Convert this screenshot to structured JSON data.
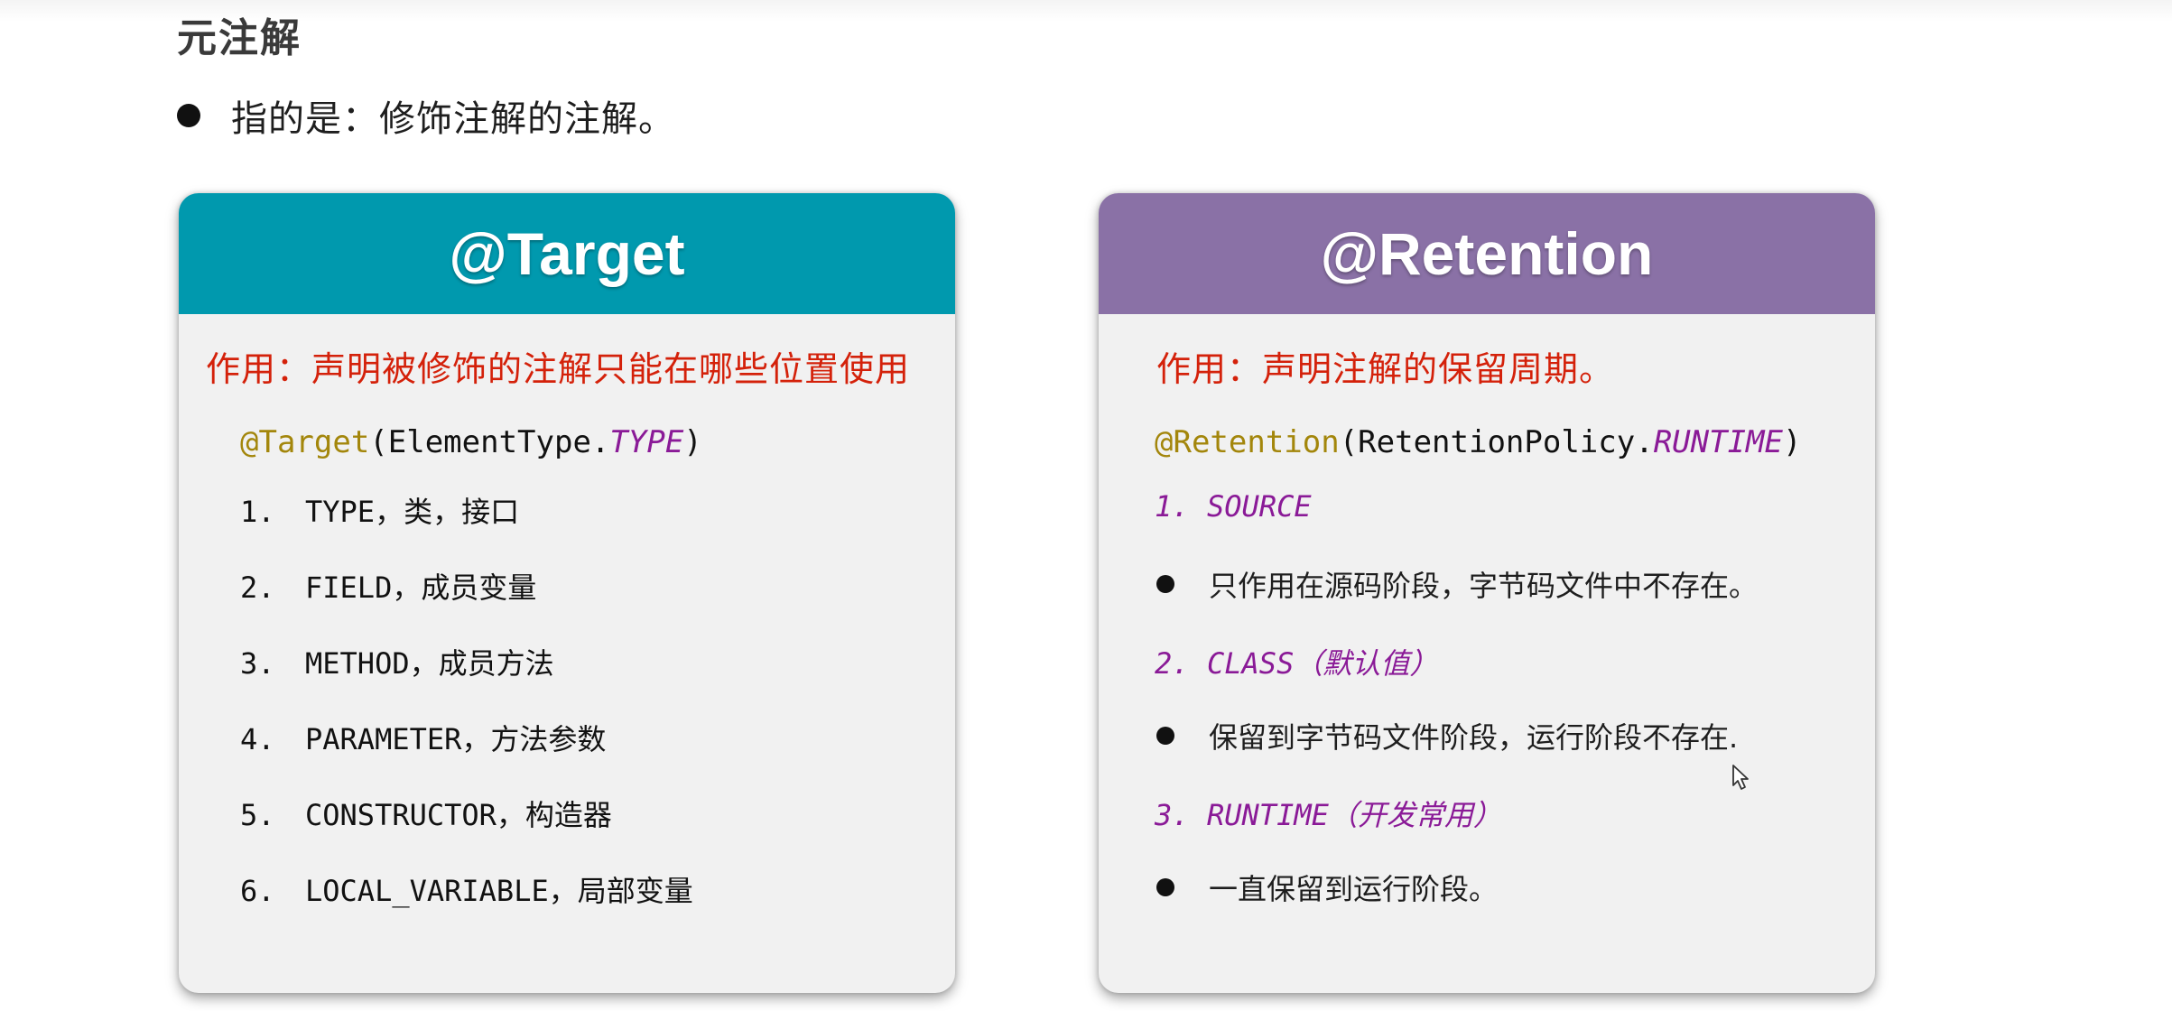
{
  "page": {
    "title": "元注解",
    "intro": "指的是：修饰注解的注解。"
  },
  "target_card": {
    "header": "@Target",
    "purpose": "作用：声明被修饰的注解只能在哪些位置使用",
    "code": {
      "annotation": "@Target",
      "open": "(ElementType.",
      "constant": "TYPE",
      "close": ")"
    },
    "items": [
      {
        "num": "1.",
        "text": "TYPE，类，接口"
      },
      {
        "num": "2.",
        "text": "FIELD，成员变量"
      },
      {
        "num": "3.",
        "text": "METHOD，成员方法"
      },
      {
        "num": "4.",
        "text": "PARAMETER，方法参数"
      },
      {
        "num": "5.",
        "text": "CONSTRUCTOR，构造器"
      },
      {
        "num": "6.",
        "text": "LOCAL_VARIABLE，局部变量"
      }
    ]
  },
  "retention_card": {
    "header": "@Retention",
    "purpose": "作用：声明注解的保留周期。",
    "code": {
      "annotation": "@Retention",
      "open": "(RetentionPolicy.",
      "constant": "RUNTIME",
      "close": ")"
    },
    "policies": [
      {
        "num": "1.",
        "name": "SOURCE",
        "desc": "只作用在源码阶段，字节码文件中不存在。"
      },
      {
        "num": "2.",
        "name": "CLASS（默认值）",
        "desc": "保留到字节码文件阶段，运行阶段不存在."
      },
      {
        "num": "3.",
        "name": "RUNTIME（开发常用）",
        "desc": "一直保留到运行阶段。"
      }
    ]
  },
  "colors": {
    "target_header": "#0099ae",
    "retention_header": "#8a71a6",
    "purpose_text": "#d4210a",
    "annotation": "#a3860b",
    "constant": "#8a1a97"
  },
  "icons": {
    "cursor": "mouse-pointer-icon"
  }
}
